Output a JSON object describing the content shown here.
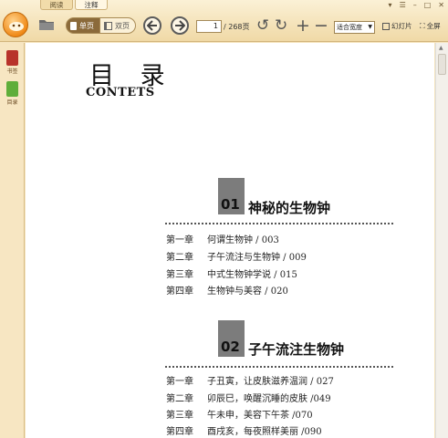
{
  "tabs": [
    {
      "label": "阅读"
    },
    {
      "label": "注释"
    }
  ],
  "toolbar": {
    "single_page": "单页",
    "double_page": "双页",
    "current_page": "1",
    "page_total": "/ 268页",
    "zoom_value": "适合宽度",
    "slideshow": "幻灯片",
    "fullscreen": "全屏"
  },
  "sidebar": {
    "items": [
      {
        "label": "书签",
        "icon": "bookmark-icon",
        "color": "#b8322a"
      },
      {
        "label": "目录",
        "icon": "toc-icon",
        "color": "#5fae3a"
      }
    ]
  },
  "document": {
    "title": "目 录",
    "subtitle": "CONTETS",
    "parts": [
      {
        "number": "01",
        "title": "神秘的生物钟",
        "chapters": [
          {
            "ch": "第一章",
            "text": "何谓生物钟 / 003"
          },
          {
            "ch": "第二章",
            "text": "子午流注与生物钟 / 009"
          },
          {
            "ch": "第三章",
            "text": "中式生物钟学说 / 015"
          },
          {
            "ch": "第四章",
            "text": "生物钟与美容 / 020"
          }
        ]
      },
      {
        "number": "02",
        "title": "子午流注生物钟",
        "chapters": [
          {
            "ch": "第一章",
            "text": "子丑寅，让皮肤滋养温润 / 027"
          },
          {
            "ch": "第二章",
            "text": "卯辰巳，唤醒沉睡的皮肤 /049"
          },
          {
            "ch": "第三章",
            "text": "午未申，美容下午茶 /070"
          },
          {
            "ch": "第四章",
            "text": "酉戌亥，每夜照样美丽 /090"
          }
        ]
      }
    ]
  },
  "colors": {
    "toolbar_bg": "#f0d9a6",
    "accent": "#f08a18",
    "part_box": "#7c7c7c"
  }
}
